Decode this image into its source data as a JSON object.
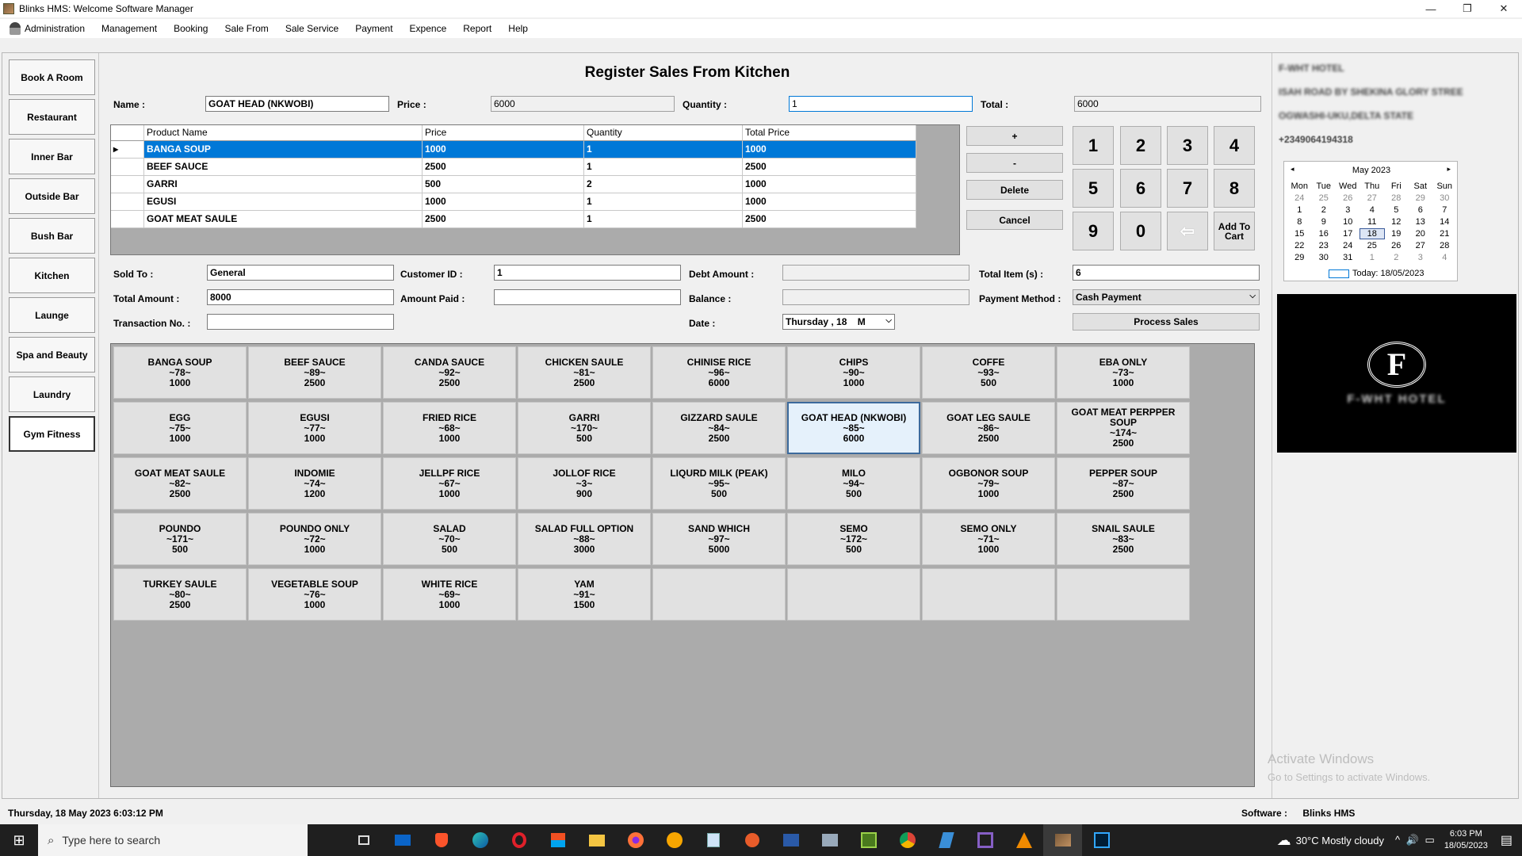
{
  "window": {
    "title": "Blinks HMS: Welcome Software Manager",
    "minimize": "—",
    "maximize": "❐",
    "close": "✕"
  },
  "menu": [
    "Administration",
    "Management",
    "Booking",
    "Sale From",
    "Sale Service",
    "Payment",
    "Expence",
    "Report",
    "Help"
  ],
  "sidebar": [
    "Book A Room",
    "Restaurant",
    "Inner Bar",
    "Outside Bar",
    "Bush Bar",
    "Kitchen",
    "Launge",
    "Spa and Beauty",
    "Laundry",
    "Gym Fitness"
  ],
  "page_title": "Register Sales From Kitchen",
  "item": {
    "name_label": "Name :",
    "name_value": "GOAT HEAD (NKWOBI)",
    "price_label": "Price :",
    "price_value": "6000",
    "quantity_label": "Quantity :",
    "quantity_value": "1",
    "total_label": "Total :",
    "total_value": "6000"
  },
  "cart": {
    "columns": [
      "Product Name",
      "Price",
      "Quantity",
      "Total Price"
    ],
    "row_marker": "▸",
    "rows": [
      [
        "BANGA SOUP",
        "1000",
        "1",
        "1000"
      ],
      [
        "BEEF SAUCE",
        "2500",
        "1",
        "2500"
      ],
      [
        "GARRI",
        "500",
        "2",
        "1000"
      ],
      [
        "EGUSI",
        "1000",
        "1",
        "1000"
      ],
      [
        "GOAT MEAT SAULE",
        "2500",
        "1",
        "2500"
      ]
    ]
  },
  "ops": {
    "plus": "+",
    "minus": "-",
    "delete": "Delete",
    "cancel": "Cancel"
  },
  "keypad": {
    "k1": "1",
    "k2": "2",
    "k3": "3",
    "k4": "4",
    "k5": "5",
    "k6": "6",
    "k7": "7",
    "k8": "8",
    "k9": "9",
    "k0": "0",
    "backspace": "⇦",
    "add_to_cart": "Add To Cart"
  },
  "sale": {
    "sold_to_label": "Sold To :",
    "sold_to_value": "General",
    "customer_id_label": "Customer ID :",
    "customer_id_value": "1",
    "debt_amount_label": "Debt Amount :",
    "debt_amount_value": "",
    "total_items_label": "Total Item (s) :",
    "total_items_value": "6",
    "total_amount_label": "Total Amount :",
    "total_amount_value": "8000",
    "amount_paid_label": "Amount Paid :",
    "amount_paid_value": "",
    "balance_label": "Balance :",
    "balance_value": "",
    "payment_method_label": "Payment Method :",
    "payment_method_value": "Cash Payment",
    "transaction_label": "Transaction No. :",
    "transaction_value": "",
    "date_label": "Date :",
    "date_value": "Thursday , 18",
    "date_value_cut": "M",
    "process_button": "Process Sales"
  },
  "food_items": [
    {
      "name": "BANGA SOUP",
      "code": "~78~",
      "price": "1000"
    },
    {
      "name": "BEEF SAUCE",
      "code": "~89~",
      "price": "2500"
    },
    {
      "name": "CANDA SAUCE",
      "code": "~92~",
      "price": "2500"
    },
    {
      "name": "CHICKEN SAULE",
      "code": "~81~",
      "price": "2500"
    },
    {
      "name": "CHINISE RICE",
      "code": "~96~",
      "price": "6000"
    },
    {
      "name": "CHIPS",
      "code": "~90~",
      "price": "1000"
    },
    {
      "name": "COFFE",
      "code": "~93~",
      "price": "500"
    },
    {
      "name": "EBA ONLY",
      "code": "~73~",
      "price": "1000"
    },
    {
      "name": "EGG",
      "code": "~75~",
      "price": "1000"
    },
    {
      "name": "EGUSI",
      "code": "~77~",
      "price": "1000"
    },
    {
      "name": "FRIED RICE",
      "code": "~68~",
      "price": "1000"
    },
    {
      "name": "GARRI",
      "code": "~170~",
      "price": "500"
    },
    {
      "name": "GIZZARD SAULE",
      "code": "~84~",
      "price": "2500"
    },
    {
      "name": "GOAT HEAD (NKWOBI)",
      "code": "~85~",
      "price": "6000"
    },
    {
      "name": "GOAT LEG SAULE",
      "code": "~86~",
      "price": "2500"
    },
    {
      "name": "GOAT MEAT PERPPER SOUP",
      "code": "~174~",
      "price": "2500"
    },
    {
      "name": "GOAT MEAT SAULE",
      "code": "~82~",
      "price": "2500"
    },
    {
      "name": "INDOMIE",
      "code": "~74~",
      "price": "1200"
    },
    {
      "name": "JELLPF RICE",
      "code": "~67~",
      "price": "1000"
    },
    {
      "name": "JOLLOF RICE",
      "code": "~3~",
      "price": "900"
    },
    {
      "name": "LIQURD MILK (PEAK)",
      "code": "~95~",
      "price": "500"
    },
    {
      "name": "MILO",
      "code": "~94~",
      "price": "500"
    },
    {
      "name": "OGBONOR SOUP",
      "code": "~79~",
      "price": "1000"
    },
    {
      "name": "PEPPER SOUP",
      "code": "~87~",
      "price": "2500"
    },
    {
      "name": "POUNDO",
      "code": "~171~",
      "price": "500"
    },
    {
      "name": "POUNDO ONLY",
      "code": "~72~",
      "price": "1000"
    },
    {
      "name": "SALAD",
      "code": "~70~",
      "price": "500"
    },
    {
      "name": "SALAD FULL OPTION",
      "code": "~88~",
      "price": "3000"
    },
    {
      "name": "SAND WHICH",
      "code": "~97~",
      "price": "5000"
    },
    {
      "name": "SEMO",
      "code": "~172~",
      "price": "500"
    },
    {
      "name": "SEMO ONLY",
      "code": "~71~",
      "price": "1000"
    },
    {
      "name": "SNAIL SAULE",
      "code": "~83~",
      "price": "2500"
    },
    {
      "name": "TURKEY SAULE",
      "code": "~80~",
      "price": "2500"
    },
    {
      "name": "VEGETABLE SOUP",
      "code": "~76~",
      "price": "1000"
    },
    {
      "name": "WHITE RICE",
      "code": "~69~",
      "price": "1000"
    },
    {
      "name": "YAM",
      "code": "~91~",
      "price": "1500"
    }
  ],
  "hotel": {
    "name": "F-WHT HOTEL",
    "address1": "ISAH ROAD BY SHEKINA GLORY STREE",
    "address2": "OGWASHI-UKU,DELTA STATE",
    "phone": "+2349064194318",
    "logo_letter": "F",
    "logo_name": "F-WHT HOTEL"
  },
  "calendar": {
    "month": "May 2023",
    "prev": "◂",
    "next": "▸",
    "days": [
      "Mon",
      "Tue",
      "Wed",
      "Thu",
      "Fri",
      "Sat",
      "Sun"
    ],
    "weeks": [
      [
        "24",
        "25",
        "26",
        "27",
        "28",
        "29",
        "30"
      ],
      [
        "1",
        "2",
        "3",
        "4",
        "5",
        "6",
        "7"
      ],
      [
        "8",
        "9",
        "10",
        "11",
        "12",
        "13",
        "14"
      ],
      [
        "15",
        "16",
        "17",
        "18",
        "19",
        "20",
        "21"
      ],
      [
        "22",
        "23",
        "24",
        "25",
        "26",
        "27",
        "28"
      ],
      [
        "29",
        "30",
        "31",
        "1",
        "2",
        "3",
        "4"
      ]
    ],
    "today": "Today: 18/05/2023"
  },
  "watermark": {
    "title": "Activate Windows",
    "subtitle": "Go to Settings to activate Windows."
  },
  "status": {
    "datetime": "Thursday, 18 May 2023 6:03:12 PM",
    "software_label": "Software :",
    "software_value": "Blinks HMS"
  },
  "taskbar": {
    "start": "⊞",
    "search_icon": "⌕",
    "search_placeholder": "Type here to search",
    "icons": [
      "task-view",
      "mail",
      "brave",
      "edge",
      "opera",
      "store",
      "explorer",
      "firefox",
      "vpn",
      "notepad",
      "app",
      "powershell",
      "manager",
      "dreamweaver",
      "chrome",
      "filezilla",
      "visual-studio",
      "vlc",
      "blinks-hms",
      "photoshop"
    ],
    "weather_icon": "☁",
    "weather": "30°C  Mostly cloudy",
    "tray": "^  🔊  ▭",
    "time": "6:03 PM",
    "date": "18/05/2023",
    "notification": "▤"
  }
}
